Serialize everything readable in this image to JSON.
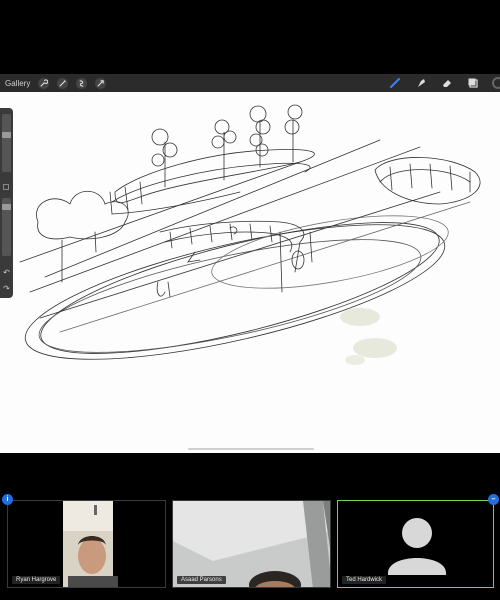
{
  "toolbar": {
    "gallery_label": "Gallery",
    "left_tools": [
      "wrench-icon",
      "magic-wand-icon",
      "selection-icon",
      "transform-arrow-icon"
    ],
    "right_tools": [
      "brush-icon",
      "smudge-icon",
      "eraser-icon",
      "layers-icon"
    ],
    "colors": {
      "bar": "#2b2b2b",
      "active_tool": "#3b82f6"
    }
  },
  "participants": [
    {
      "name": "Ryan Hargrove",
      "badge": "i"
    },
    {
      "name": "Asaad Parsons"
    },
    {
      "name": "Ted Hardwick",
      "active_speaker": true
    }
  ],
  "colors": {
    "active_speaker_border": "#6fd64a",
    "badge": "#1e6fe0"
  }
}
